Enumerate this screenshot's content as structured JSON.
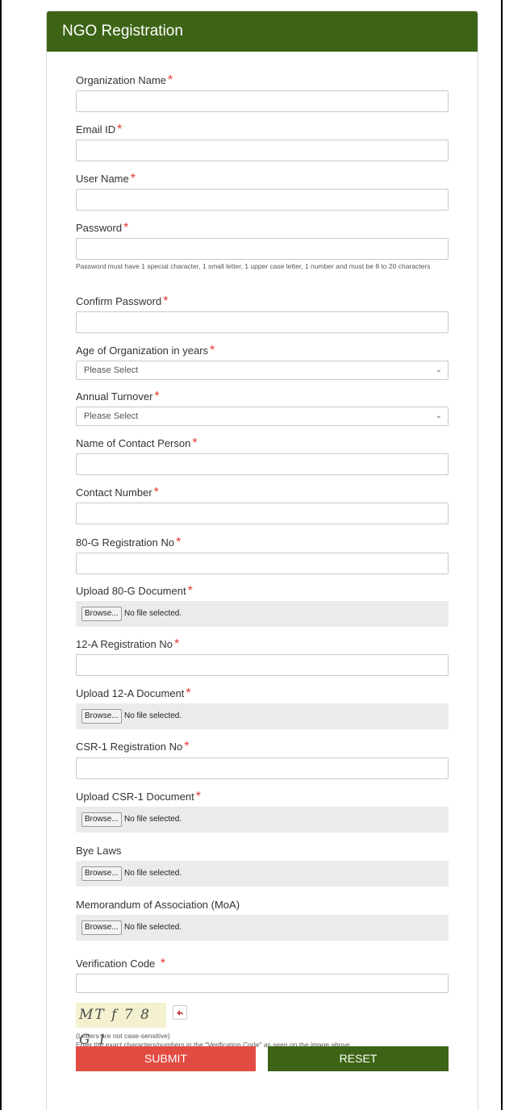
{
  "form": {
    "title": "NGO Registration",
    "required_mark": "*",
    "fields": {
      "org_name": {
        "label": "Organization Name",
        "value": ""
      },
      "email": {
        "label": "Email ID",
        "value": ""
      },
      "username": {
        "label": "User Name",
        "value": ""
      },
      "password": {
        "label": "Password",
        "value": "",
        "help": "Password must have 1 special character, 1 small letter, 1 upper case letter, 1 number and must be 8 to 20 characters"
      },
      "confirm_password": {
        "label": "Confirm Password",
        "value": ""
      },
      "age": {
        "label": "Age of Organization in years",
        "selected": "Please Select"
      },
      "turnover": {
        "label": "Annual Turnover",
        "selected": "Please Select"
      },
      "contact_person": {
        "label": "Name of Contact Person",
        "value": ""
      },
      "contact_number": {
        "label": "Contact Number",
        "value": ""
      },
      "reg_80g": {
        "label": "80-G Registration No",
        "value": ""
      },
      "upload_80g": {
        "label": "Upload 80-G Document"
      },
      "reg_12a": {
        "label": "12-A Registration No",
        "value": ""
      },
      "upload_12a": {
        "label": "Upload 12-A Document"
      },
      "reg_csr1": {
        "label": "CSR-1 Registration No",
        "value": ""
      },
      "upload_csr1": {
        "label": "Upload CSR-1 Document"
      },
      "bye_laws": {
        "label": "Bye Laws"
      },
      "moa": {
        "label": "Memorandum of Association (MoA)"
      },
      "verification": {
        "label": "Verification Code",
        "value": ""
      }
    },
    "file_input": {
      "browse_label": "Browse...",
      "status": "No file selected."
    },
    "captcha": {
      "text": "MT f 7 8 G 1",
      "note": "(Letters are not case-sensitive)",
      "instruction": "Enter the exact characters/numbers in the \"Verification Code\" as seen on the image above."
    },
    "buttons": {
      "submit": "SUBMIT",
      "reset": "RESET"
    },
    "colors": {
      "header": "#3d6416",
      "submit": "#e24b42",
      "reset": "#3d6416",
      "required": "#e53a33"
    }
  }
}
